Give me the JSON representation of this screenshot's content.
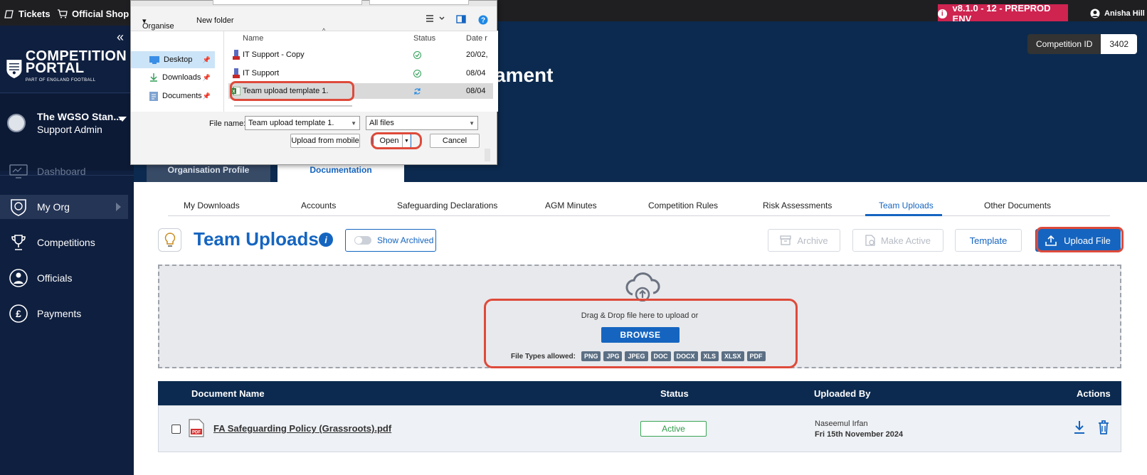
{
  "topbar": {
    "tickets": "Tickets",
    "shop": "Official Shop",
    "env": "v8.1.0 - 12 - PREPROD ENV",
    "user": "Anisha Hill"
  },
  "sidebar": {
    "logo_main": "COMPETITION",
    "logo_main2": "PORTAL",
    "logo_sub": "PART OF ENGLAND FOOTBALL",
    "org_name": "The WGSO Stan...",
    "org_role": "Support Admin",
    "nav": [
      {
        "label": "Dashboard"
      },
      {
        "label": "My Org"
      },
      {
        "label": "Competitions"
      },
      {
        "label": "Officials"
      },
      {
        "label": "Payments"
      }
    ]
  },
  "header": {
    "title_fragment": "ament",
    "comp_id_label": "Competition ID",
    "comp_id_value": "3402",
    "profile_tabs": [
      "Organisation Profile",
      "Documentation"
    ]
  },
  "subtabs": [
    "My Downloads",
    "Accounts",
    "Safeguarding Declarations",
    "AGM Minutes",
    "Competition Rules",
    "Risk Assessments",
    "Team Uploads",
    "Other Documents"
  ],
  "page": {
    "title": "Team Uploads",
    "show_archived": "Show Archived",
    "archive": "Archive",
    "make_active": "Make Active",
    "template": "Template",
    "upload_file": "Upload File"
  },
  "dropzone": {
    "text": "Drag & Drop file here to upload or",
    "browse": "BROWSE",
    "types_label": "File Types allowed:",
    "types": [
      "PNG",
      "JPG",
      "JPEG",
      "DOC",
      "DOCX",
      "XLS",
      "XLSX",
      "PDF"
    ]
  },
  "table": {
    "headers": {
      "name": "Document Name",
      "status": "Status",
      "uploaded_by": "Uploaded By",
      "actions": "Actions"
    },
    "rows": [
      {
        "name": "FA Safeguarding Policy (Grassroots).pdf",
        "status": "Active",
        "uploader": "Naseemul Irfan",
        "date": "Fri 15th November 2024"
      }
    ]
  },
  "dialog": {
    "organise": "Organise",
    "new_folder": "New folder",
    "left": [
      "Desktop",
      "Downloads",
      "Documents"
    ],
    "cols": {
      "name": "Name",
      "status": "Status",
      "date": "Date r"
    },
    "files": [
      {
        "name": "IT Support - Copy",
        "date": "20/02,"
      },
      {
        "name": "IT Support",
        "date": "08/04"
      },
      {
        "name": "Team upload template 1.",
        "date": "08/04"
      }
    ],
    "file_name_label": "File name:",
    "file_name_value": "Team upload template 1.",
    "file_type": "All files",
    "upload_mobile": "Upload from mobile",
    "open": "Open",
    "cancel": "Cancel"
  },
  "colors": {
    "navy": "#0c2a4f",
    "sidebar": "#0f1f3f",
    "accent": "#1565c0",
    "env": "#cf2350",
    "highlight": "#de4a3a",
    "active": "#3aa655"
  }
}
